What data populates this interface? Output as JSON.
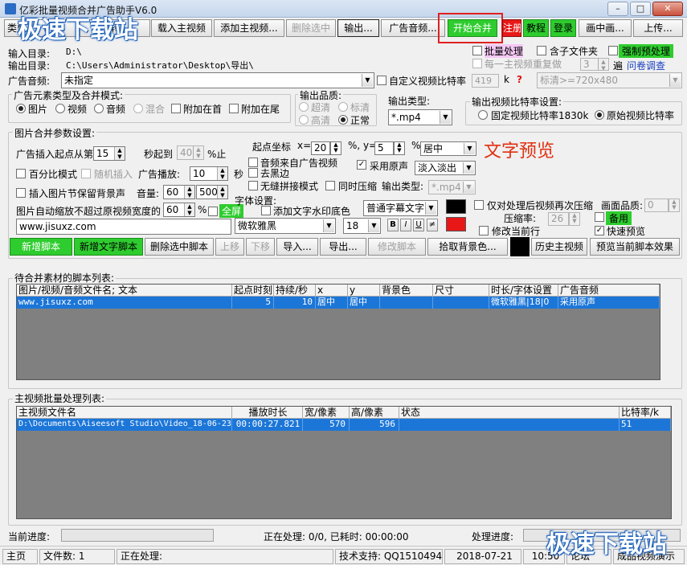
{
  "window": {
    "title": "亿彩批量视频合并广告助手V6.0",
    "min": "–",
    "max": "□",
    "close": "✕"
  },
  "watermark": "极速下载站",
  "toolbar": {
    "b1": "类型",
    "b2": "mp4",
    "b3": "转",
    "load_main": "载入主视频",
    "add_main": "添加主视频...",
    "delete_sel": "删除选中",
    "output": "输出...",
    "ad_audio": "广告音频...",
    "start_merge": "开始合并",
    "register": "注册",
    "tutorial": "教程",
    "login": "登录",
    "pip": "画中画...",
    "upload": "上传..."
  },
  "paths": {
    "input_label": "输入目录:",
    "input_value": "D:\\",
    "output_label": "输出目录:",
    "output_value": "C:\\Users\\Administrator\\Desktop\\导出\\"
  },
  "right_opts": {
    "batch": "批量处理",
    "subfolders": "含子文件夹",
    "force_pre": "强制预处理",
    "repeat_each": "每一主视频重复做",
    "repeat_count": "3",
    "times": "遍",
    "survey": "问卷调查"
  },
  "ad_audio": {
    "label": "广告音频:",
    "value": "未指定",
    "custom_bitrate": "自定义视频比特率",
    "bitrate_value": "419",
    "unit": "k",
    "help": "?",
    "quality_select": "标清>=720x480"
  },
  "ad_type": {
    "legend": "广告元素类型及合并模式:",
    "image": "图片",
    "video": "视频",
    "audio": "音频",
    "mix": "混合",
    "head": "附加在首",
    "tail": "附加在尾"
  },
  "out_quality": {
    "legend": "输出品质:",
    "super": "超清",
    "standard": "标清",
    "high": "高清",
    "normal": "正常"
  },
  "out_type": {
    "label": "输出类型:",
    "value": "*.mp4"
  },
  "bitrate_setting": {
    "legend": "输出视频比特率设置:",
    "fixed": "固定视频比特率1830k",
    "original": "原始视频比特率"
  },
  "params": {
    "legend": "图片合并参数设置:",
    "insert_from": "广告插入起点从第",
    "start_sec": "15",
    "sec_to": "秒起到",
    "end_value": "40",
    "stop": "%止",
    "percent_mode": "百分比模式",
    "random_insert": "随机插入",
    "ad_play": "广告播放:",
    "play_sec": "10",
    "sec": "秒",
    "keep_bg": "插入图片节保留背景声",
    "volume_label": "音量:",
    "volume1": "60",
    "volume2": "500",
    "auto_scale": "图片自动缩放不超过原视频宽度的",
    "scale_value": "60",
    "pct": "%",
    "fullscreen": "全屏",
    "url": "www.jisuxz.com",
    "start_coord": "起点坐标",
    "x_label": "x=",
    "x_value": "20",
    "pct_y": "%, y=",
    "y_value": "5",
    "pct2": "%",
    "align": "居中",
    "preview_text": "文字预览",
    "audio_from_ad": "音频来自广告视频",
    "remove_black": "去黑边",
    "use_original": "采用原声",
    "fade": "淡入淡出",
    "seamless": "无缝拼接模式",
    "sync_compress": "同时压缩",
    "out_type2_label": "输出类型:",
    "out_type2_value": "*.mp4",
    "font_settings": "字体设置:",
    "add_watermark_bg": "添加文字水印底色",
    "subtitle_style": "普通字幕文字",
    "font_name": "微软雅黑",
    "font_size": "18",
    "bold": "B",
    "italic": "I",
    "underline": "U",
    "strike": "≠",
    "compress_again": "仅对处理后视频再次压缩",
    "frame_quality": "画面品质:",
    "frame_quality_value": "0",
    "compress_rate": "压缩率:",
    "compress_value": "26",
    "spare": "备用",
    "modify_prev": "修改当前行",
    "quick_preview": "快速预览"
  },
  "script_buttons": {
    "new_script": "新增脚本",
    "new_text_script": "新增文字脚本",
    "delete_script": "删除选中脚本",
    "up": "上移",
    "down": "下移",
    "import": "导入...",
    "export": "导出...",
    "edit_script": "修改脚本",
    "pick_bg": "拾取背景色...",
    "history_main": "历史主视频",
    "preview_effect": "预览当前脚本效果"
  },
  "script_list": {
    "legend": "待合并素材的脚本列表:",
    "headers": [
      "图片/视频/音频文件名; 文本",
      "起点时刻",
      "持续/秒",
      "x",
      "y",
      "背景色",
      "尺寸",
      "时长/字体设置",
      "广告音频"
    ],
    "row": [
      "www.jisuxz.com",
      "5",
      "10",
      "居中",
      "居中",
      "",
      "",
      "微软雅黑|18|0",
      "采用原声"
    ]
  },
  "main_list": {
    "legend": "主视频批量处理列表:",
    "headers": [
      "主视频文件名",
      "播放时长",
      "宽/像素",
      "高/像素",
      "状态",
      "比特率/k"
    ],
    "row": [
      "D:\\Documents\\Aiseesoft Studio\\Video_18-06-23",
      "00:00:27.821",
      "570",
      "596",
      "",
      "51"
    ]
  },
  "progress": {
    "current": "当前进度:",
    "processing": "正在处理: 0/0, 已耗时: 00:00:00",
    "proc_progress": "处理进度:"
  },
  "status": {
    "home": "主页",
    "file_count": "文件数: 1",
    "processing": "正在处理:",
    "support": "技术支持: QQ15104946",
    "date": "2018-07-21",
    "time": "10:50",
    "forum": "论坛",
    "show_video": "成品视频演示"
  },
  "colors": {
    "accent_green": "#2ecc2e",
    "accent_red": "#e81818",
    "selection": "#1c76d8",
    "preview_red": "#e03010"
  }
}
